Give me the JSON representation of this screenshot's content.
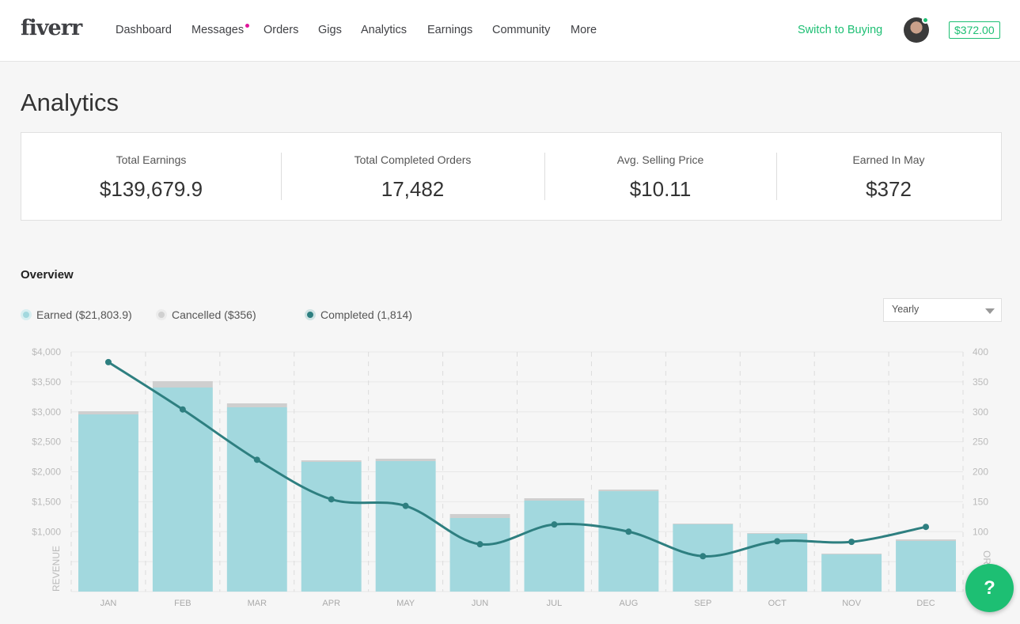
{
  "header": {
    "logo": "fiverr",
    "nav": [
      "Dashboard",
      "Messages",
      "Orders",
      "Gigs",
      "Analytics",
      "Earnings",
      "Community",
      "More"
    ],
    "switch_label": "Switch to Buying",
    "balance": "$372.00"
  },
  "page_title": "Analytics",
  "stats": [
    {
      "label": "Total Earnings",
      "value": "$139,679.9"
    },
    {
      "label": "Total Completed Orders",
      "value": "17,482"
    },
    {
      "label": "Avg. Selling Price",
      "value": "$10.11"
    },
    {
      "label": "Earned In May",
      "value": "$372"
    }
  ],
  "overview": {
    "title": "Overview",
    "legend": [
      {
        "label": "Earned ($21,803.9)",
        "color": "#a2d8de"
      },
      {
        "label": "Cancelled ($356)",
        "color": "#d0d0d0"
      },
      {
        "label": "Completed (1,814)",
        "color": "#2e7f80"
      }
    ],
    "period": "Yearly"
  },
  "help_label": "?",
  "chart_data": {
    "type": "bar+line",
    "categories": [
      "JAN",
      "FEB",
      "MAR",
      "APR",
      "MAY",
      "JUN",
      "JUL",
      "AUG",
      "SEP",
      "OCT",
      "NOV",
      "DEC"
    ],
    "left_axis": {
      "label": "REVENUE",
      "ylim": [
        0,
        4000
      ],
      "ticks": [
        "$4,000",
        "$3,500",
        "$3,000",
        "$2,500",
        "$2,000",
        "$1,500",
        "$1,000"
      ]
    },
    "right_axis": {
      "label": "ORDERS",
      "ylim": [
        0,
        400
      ],
      "ticks": [
        "400",
        "350",
        "300",
        "250",
        "200",
        "150",
        "100"
      ]
    },
    "series": [
      {
        "name": "Earned",
        "type": "bar",
        "values": [
          2957,
          3406,
          3076,
          2165,
          2178,
          1228,
          1518,
          1676,
          1122,
          964,
          620,
          845
        ]
      },
      {
        "name": "Cancelled",
        "type": "bar-stacked",
        "values": [
          53,
          106,
          66,
          26,
          40,
          66,
          40,
          27,
          13,
          13,
          14,
          26
        ]
      },
      {
        "name": "Completed",
        "type": "line",
        "axis": "right",
        "values": [
          383,
          304,
          220,
          154,
          143,
          79,
          112,
          100,
          59,
          84,
          83,
          108
        ]
      }
    ],
    "grid": true
  }
}
